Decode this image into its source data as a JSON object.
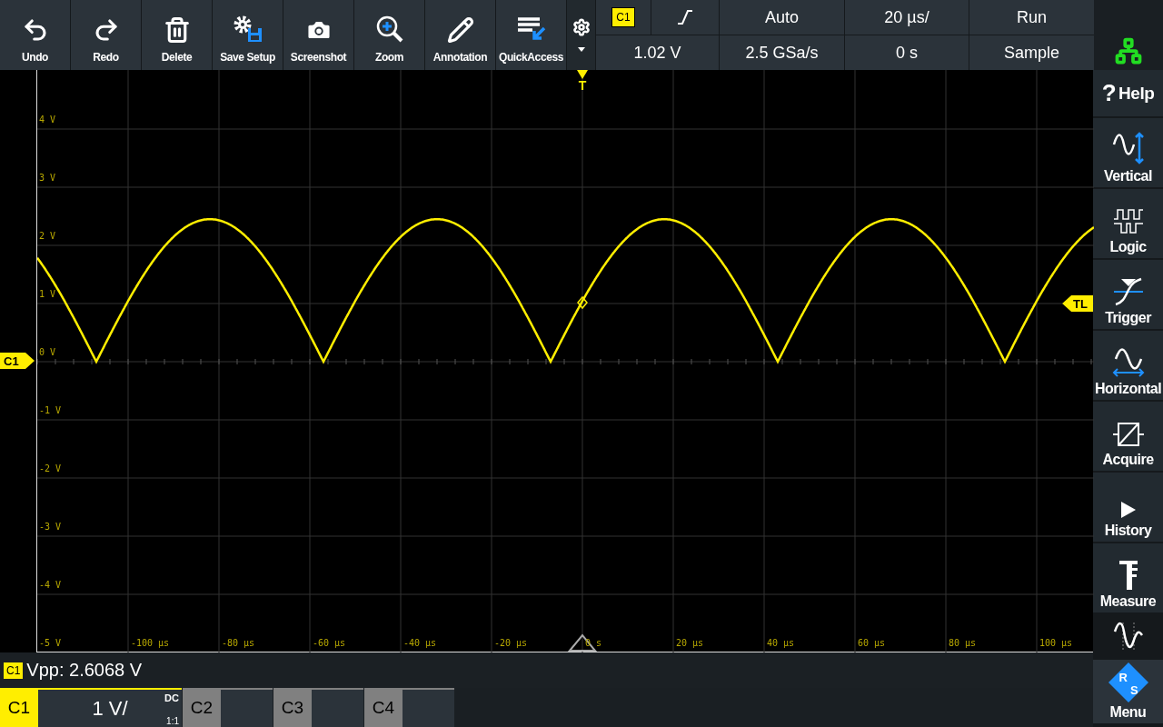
{
  "toolbar": [
    {
      "label": "Undo",
      "kind": "undo"
    },
    {
      "label": "Redo",
      "kind": "redo"
    },
    {
      "label": "Delete",
      "kind": "delete"
    },
    {
      "label": "Save Setup",
      "kind": "save"
    },
    {
      "label": "Screenshot",
      "kind": "screenshot"
    },
    {
      "label": "Zoom",
      "kind": "zoom"
    },
    {
      "label": "Annotation",
      "kind": "annotation"
    },
    {
      "label": "QuickAccess",
      "kind": "quickaccess"
    }
  ],
  "trigger_panel": {
    "source": "C1",
    "slope": {
      "kind": "rising"
    },
    "mode": "Auto",
    "timebase": "20 µs/",
    "run_state": "Run",
    "level": "1.02 V",
    "sample_rate": "2.5 GSa/s",
    "position": "0 s",
    "acquisition": "Sample"
  },
  "plot": {
    "y_labels": [
      "4 V",
      "3 V",
      "2 V",
      "1 V",
      "0 V",
      "-1 V",
      "-2 V",
      "-3 V",
      "-4 V",
      "-5 V"
    ],
    "x_labels": [
      "-100 µs",
      "-80 µs",
      "-60 µs",
      "-40 µs",
      "-20 µs",
      "0 s",
      "20 µs",
      "40 µs",
      "60 µs",
      "80 µs",
      "100 µs"
    ],
    "markers": {
      "channel": "C1",
      "trigger_level": "TL",
      "trigger_time": "T"
    }
  },
  "sidebar": [
    {
      "kind": "help",
      "glyph": "?",
      "label": "Help"
    },
    {
      "kind": "vertical",
      "label": "Vertical"
    },
    {
      "kind": "logic",
      "label": "Logic"
    },
    {
      "kind": "trigger",
      "label": "Trigger"
    },
    {
      "kind": "horizontal",
      "label": "Horizontal"
    },
    {
      "kind": "acquire",
      "label": "Acquire"
    },
    {
      "kind": "history",
      "label": "History"
    },
    {
      "kind": "measure",
      "label": "Measure"
    },
    {
      "kind": "wave"
    },
    {
      "kind": "menu",
      "label": "Menu",
      "logo": [
        "R",
        "S"
      ]
    }
  ],
  "measurement": {
    "source": "C1",
    "text": "Vpp: 2.6068 V"
  },
  "channels": [
    {
      "label": "C1",
      "on": true,
      "scale": "1 V/",
      "coupling": "DC",
      "probe": "1:1"
    },
    {
      "label": "C2",
      "on": false
    },
    {
      "label": "C3",
      "on": false
    },
    {
      "label": "C4",
      "on": false
    }
  ]
}
